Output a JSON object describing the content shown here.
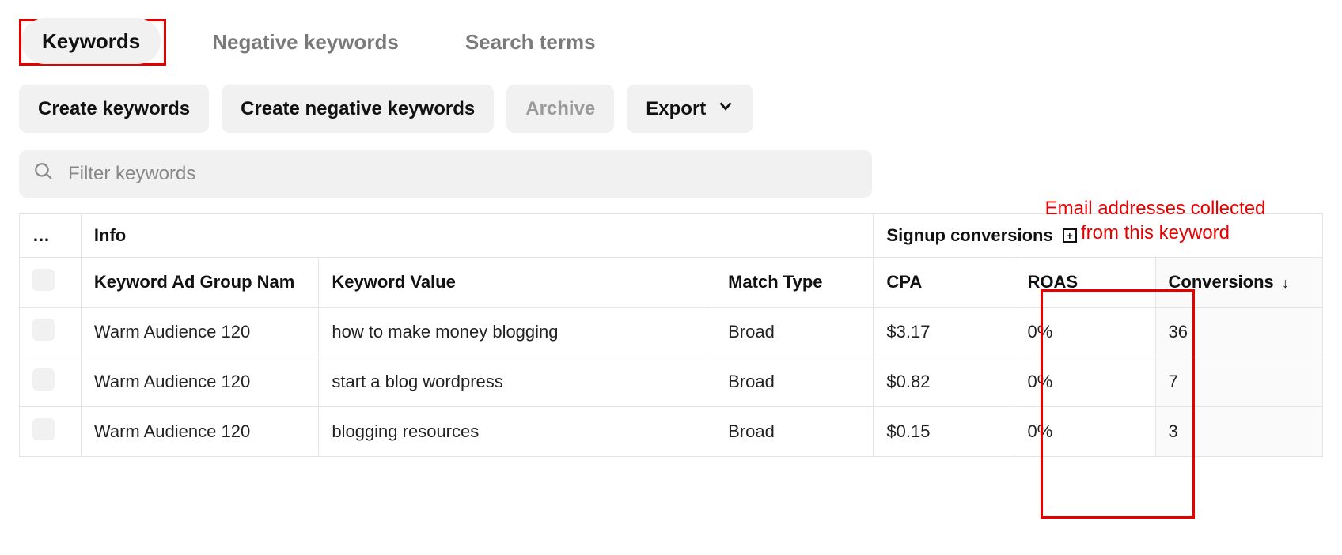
{
  "tabs": {
    "keywords": "Keywords",
    "negative": "Negative keywords",
    "search_terms": "Search terms"
  },
  "actions": {
    "create_keywords": "Create keywords",
    "create_negative": "Create negative keywords",
    "archive": "Archive",
    "export": "Export"
  },
  "filter": {
    "placeholder": "Filter keywords"
  },
  "table": {
    "group_headers": {
      "select": "…",
      "info": "Info",
      "signup": "Signup conversions"
    },
    "sub_headers": {
      "ad_group": "Keyword Ad Group Nam",
      "value": "Keyword Value",
      "match": "Match Type",
      "cpa": "CPA",
      "roas": "ROAS",
      "conversions": "Conversions"
    },
    "rows": [
      {
        "ad_group": "Warm Audience 120",
        "value": "how to make money blogging",
        "match": "Broad",
        "cpa": "$3.17",
        "roas": "0%",
        "conversions": "36"
      },
      {
        "ad_group": "Warm Audience 120",
        "value": "start a blog wordpress",
        "match": "Broad",
        "cpa": "$0.82",
        "roas": "0%",
        "conversions": "7"
      },
      {
        "ad_group": "Warm Audience 120",
        "value": "blogging resources",
        "match": "Broad",
        "cpa": "$0.15",
        "roas": "0%",
        "conversions": "3"
      }
    ]
  },
  "annotation": "Email addresses collected from this keyword"
}
